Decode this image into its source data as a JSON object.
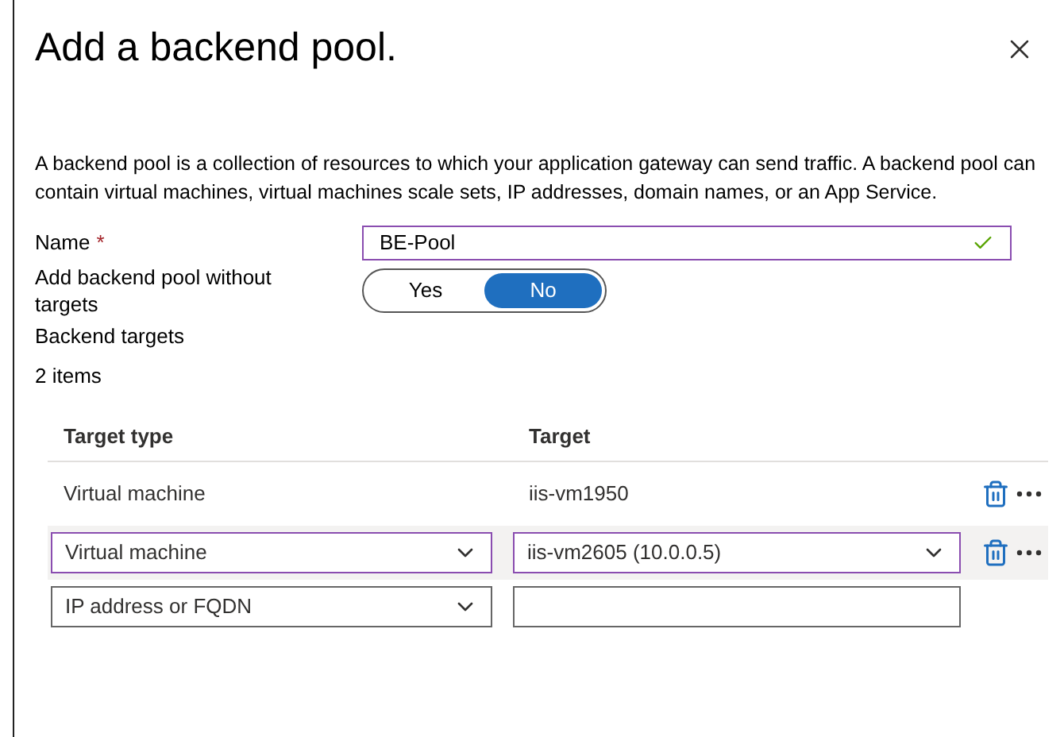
{
  "panel": {
    "title": "Add a backend pool.",
    "description": "A backend pool is a collection of resources to which your application gateway can send traffic. A backend pool can contain virtual machines, virtual machines scale sets, IP addresses, domain names, or an App Service."
  },
  "name_field": {
    "label": "Name",
    "required_mark": "*",
    "value": "BE-Pool",
    "valid": true
  },
  "without_targets": {
    "label": "Add backend pool without targets",
    "options": [
      {
        "label": "Yes",
        "selected": false
      },
      {
        "label": "No",
        "selected": true
      }
    ]
  },
  "targets": {
    "heading": "Backend targets",
    "count": "2 items",
    "columns": [
      "Target type",
      "Target"
    ],
    "rows": [
      {
        "kind": "static",
        "type": "Virtual machine",
        "target": "iis-vm1950",
        "focused": false,
        "actions": true
      },
      {
        "kind": "edit",
        "type": "Virtual machine",
        "target": "iis-vm2605 (10.0.0.5)",
        "focused": true,
        "actions": true
      },
      {
        "kind": "edit",
        "type": "IP address or FQDN",
        "focused": false,
        "actions": false
      }
    ]
  }
}
